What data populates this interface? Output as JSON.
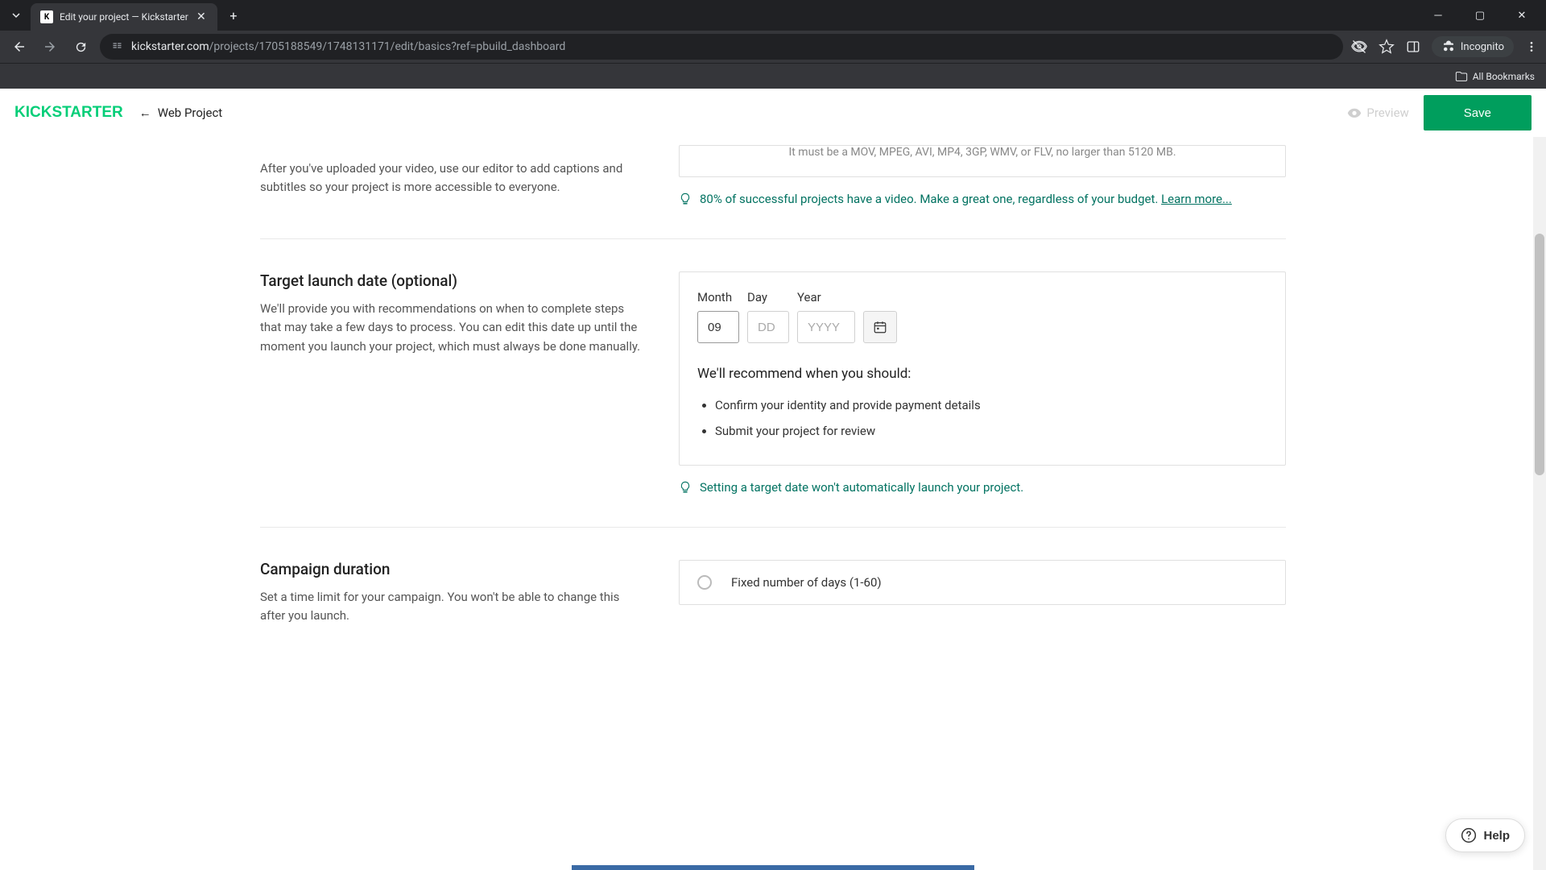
{
  "browser": {
    "tab_title": "Edit your project — Kickstarter",
    "url_domain": "kickstarter.com",
    "url_path": "/projects/1705188549/1748131171/edit/basics?ref=pbuild_dashboard",
    "incognito_label": "Incognito",
    "all_bookmarks": "All Bookmarks"
  },
  "header": {
    "logo": "KICKSTARTER",
    "back_label": "Web Project",
    "preview_label": "Preview",
    "save_label": "Save"
  },
  "video": {
    "hint_text": "After you've uploaded your video, use our editor to add captions and subtitles so your project is more accessible to everyone.",
    "upload_hint": "It must be a MOV, MPEG, AVI, MP4, 3GP, WMV, or FLV, no larger than 5120 MB.",
    "tip": "80% of successful projects have a video. Make a great one, regardless of your budget. ",
    "tip_link": "Learn more..."
  },
  "launch": {
    "heading": "Target launch date (optional)",
    "description": "We'll provide you with recommendations on when to complete steps that may take a few days to process. You can edit this date up until the moment you launch your project, which must always be done manually.",
    "month_label": "Month",
    "day_label": "Day",
    "year_label": "Year",
    "month_value": "09",
    "day_placeholder": "DD",
    "year_placeholder": "YYYY",
    "recommend_heading": "We'll recommend when you should:",
    "recommend_items": [
      "Confirm your identity and provide payment details",
      "Submit your project for review"
    ],
    "tip": "Setting a target date won't automatically launch your project."
  },
  "duration": {
    "heading": "Campaign duration",
    "description": "Set a time limit for your campaign. You won't be able to change this after you launch.",
    "option_fixed": "Fixed number of days (1-60)"
  },
  "help_label": "Help"
}
